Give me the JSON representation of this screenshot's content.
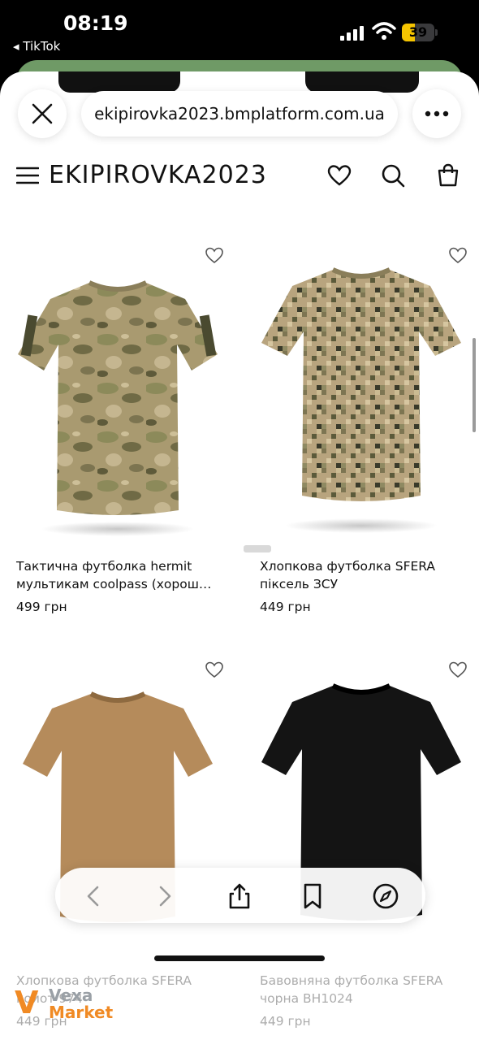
{
  "status_bar": {
    "time": "08:19",
    "back_app": "◂ TikTok",
    "battery": "39",
    "battery_level": 0.39
  },
  "browser": {
    "url": "ekipirovka2023.bmplatform.com.ua"
  },
  "site": {
    "logo": "EKIPIROVKA2023"
  },
  "products": [
    {
      "name": "Тактична футболка hermit мультикам coolpass (хорош…",
      "price": "499 грн",
      "shirt_color": "multicam"
    },
    {
      "name": "Хлопкова футболка SFERA піксель ЗСУ",
      "price": "449 грн",
      "shirt_color": "pixel"
    },
    {
      "name": "Хлопкова футболка SFERA койот 974",
      "price": "449 грн",
      "shirt_color": "#b58b5b"
    },
    {
      "name": "Бавовняна футболка SFERA чорна BH1024",
      "price": "449 грн",
      "shirt_color": "#141414"
    }
  ],
  "watermark": {
    "v": "V",
    "line1": "Vexa",
    "line2": "Market"
  },
  "icons": [
    "close-icon",
    "more-icon",
    "menu-icon",
    "heart-icon",
    "search-icon",
    "bag-icon",
    "back-icon",
    "forward-icon",
    "share-icon",
    "bookmarks-icon",
    "compass-icon"
  ]
}
